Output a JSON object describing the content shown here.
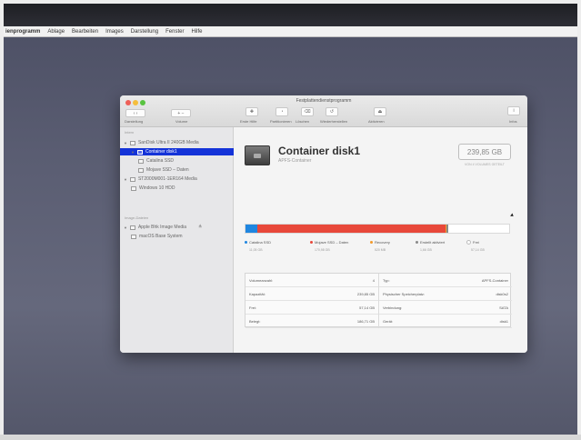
{
  "menubar": [
    "ienprogramm",
    "Ablage",
    "Bearbeiten",
    "Images",
    "Darstellung",
    "Fenster",
    "Hilfe"
  ],
  "window": {
    "title": "Festplattendienstprogramm",
    "toolbar": {
      "nav_back": "‹ ›",
      "darstellung_label": "Darstellung",
      "volume_label": "Volume",
      "buttons": [
        {
          "icon": "first-aid-icon",
          "label": "Erste Hilfe"
        },
        {
          "icon": "partition-icon",
          "label": "Partitionieren"
        },
        {
          "icon": "erase-icon",
          "label": "Löschen"
        },
        {
          "icon": "restore-icon",
          "label": "Wiederherstellen"
        },
        {
          "icon": "unmount-icon",
          "label": "Aktivieren"
        }
      ],
      "info_label": "Infos"
    }
  },
  "sidebar": {
    "section_intern": "Intern",
    "section_images": "Image-Dateien",
    "items": [
      {
        "label": "SanDisk Ultra II 240GB Media",
        "level": 0,
        "disclosure": "▼"
      },
      {
        "label": "Container disk1",
        "level": 1,
        "disclosure": "▼",
        "selected": true
      },
      {
        "label": "Catalina SSD",
        "level": 2
      },
      {
        "label": "Mojave SSD – Daten",
        "level": 2
      },
      {
        "label": "ST2000M001-1ER164 Media",
        "level": 0,
        "disclosure": "▼"
      },
      {
        "label": "Windows 10 HDD",
        "level": 1
      },
      {
        "label": "Apple Bhk Image Media",
        "level": 0,
        "disclosure": "▼",
        "eject": "≜"
      },
      {
        "label": "macOS Base System",
        "level": 1
      }
    ]
  },
  "volume": {
    "title": "Container disk1",
    "subtitle": "APFS-Container",
    "size": "239,85 GB",
    "size_caption": "VON 4 VOLUMES GETEILT"
  },
  "usage": {
    "segments": [
      {
        "name": "Catalina SSD",
        "value": "11,05 GB",
        "color": "#1f86e0",
        "fraction": 0.046
      },
      {
        "name": "Mojave SSD – Daten",
        "value": "170,98 GB",
        "color": "#e8483a",
        "fraction": 0.713
      },
      {
        "name": "Recovery",
        "value": "520 MB",
        "color": "#f39a2b",
        "fraction": 0.002
      },
      {
        "name": "Erstellt aktiviert",
        "value": "1,66 GB",
        "color": "#8a8a8a",
        "fraction": 0.007
      },
      {
        "name": "Frei",
        "value": "57,14 GB",
        "color": "#ffffff",
        "fraction": 0.232
      }
    ]
  },
  "info": {
    "left": [
      {
        "label": "Volumeanzahl:",
        "value": "4"
      },
      {
        "label": "Kapazität:",
        "value": "239,85 GB"
      },
      {
        "label": "Frei:",
        "value": "57,14 GB"
      },
      {
        "label": "Belegt:",
        "value": "186,71 GB"
      }
    ],
    "right": [
      {
        "label": "Typ:",
        "value": "APFS-Container"
      },
      {
        "label": "Physischer Speicherplatz:",
        "value": "disk0s2"
      },
      {
        "label": "Verbindung:",
        "value": "SATA"
      },
      {
        "label": "Gerät:",
        "value": "disk1"
      }
    ]
  }
}
